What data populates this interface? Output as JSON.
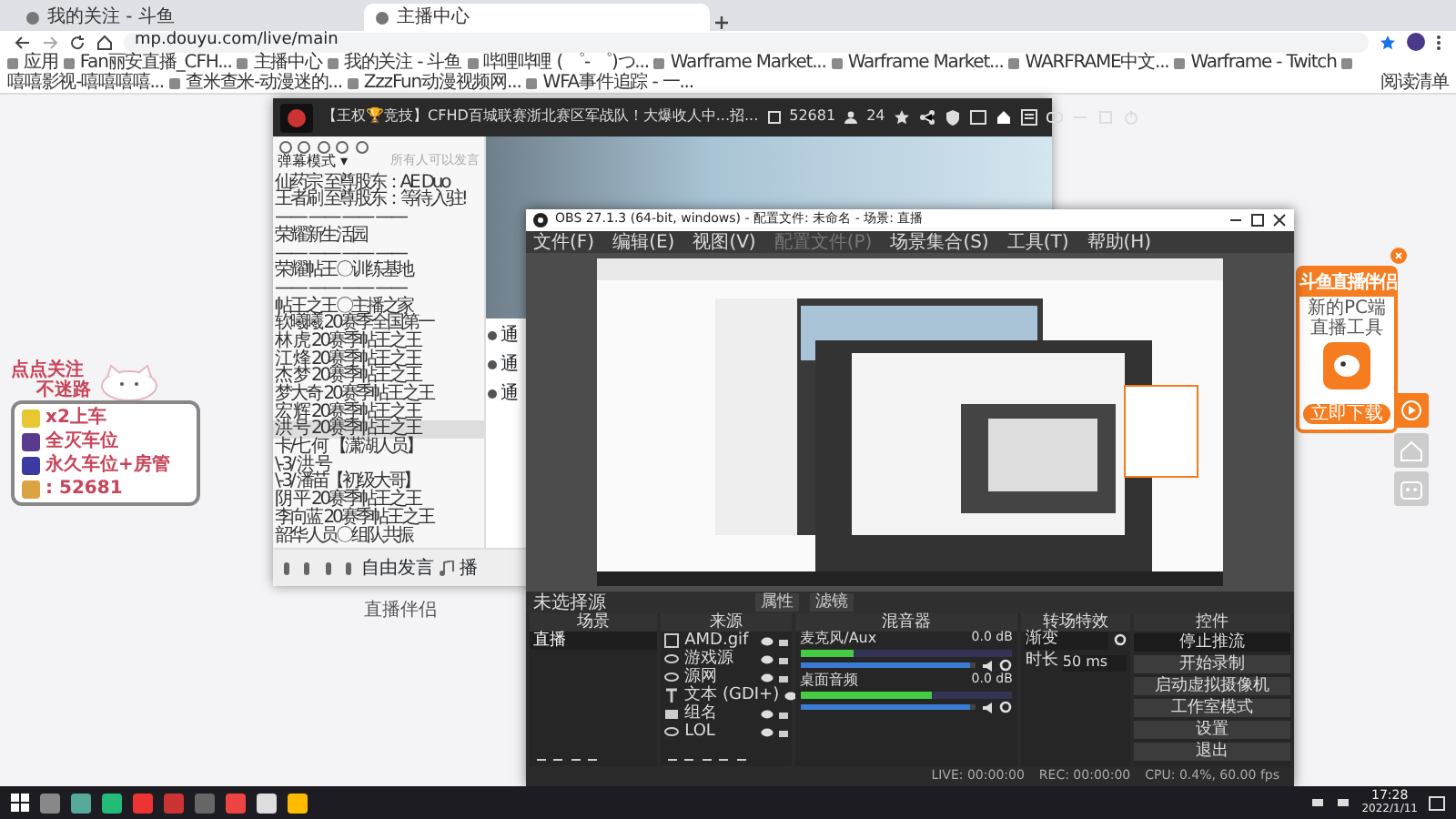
{
  "browser": {
    "tabs": [
      {
        "title": "我的关注 - 斗鱼",
        "selected": false
      },
      {
        "title": "主播中心",
        "selected": true
      }
    ],
    "address": "mp.douyu.com/live/main",
    "bookmarks": [
      "应用",
      "Fan丽安直播_CFH...",
      "主播中心",
      "我的关注 - 斗鱼",
      "哔哩哔哩 ( ゜- ゜)つ...",
      "Warframe Market...",
      "Warframe Market...",
      "WARFRAME中文...",
      "Warframe - Twitch",
      "嘻嘻影视-嘻嘻嘻嘻...",
      "查米查米-动漫迷的...",
      "ZzzFun动漫视频网...",
      "WFA事件追踪 - 一..."
    ],
    "reading_list": "阅读清单"
  },
  "promo_sticker": {
    "headline": [
      "点点关注",
      "不迷路"
    ],
    "items": [
      "x2上车",
      "全灭车位",
      "永久车位+房管",
      ": 52681"
    ]
  },
  "page_links": [
    "通",
    "通",
    "通"
  ],
  "page_footer": "直播伴侣",
  "ad": {
    "title": "斗鱼直播伴侣",
    "subtitle": "新的PC端直播工具",
    "button": "立即下载"
  },
  "player": {
    "title": "【王权🏆竞技】CFHD百城联赛浙北赛区军战队！大爆收人中...招...",
    "viewers": "52681",
    "followers": "24",
    "chat_mode": "弹幕模式 ▾",
    "chat_hint": "所有人可以发言",
    "chat": [
      {
        "text": "仙药宗  至尊股东：AE Duo",
        "selected": false
      },
      {
        "text": "王者刷  至尊股东：等待入驻!",
        "selected": false
      },
      {
        "text": "—— —— —— ——",
        "selected": false
      },
      {
        "text": "荣耀新生活园",
        "selected": false
      },
      {
        "text": "—— —— —— ——",
        "selected": false
      },
      {
        "text": "荣耀帖王〇训练基地",
        "selected": false
      },
      {
        "text": "—— —— —— ——",
        "selected": false
      },
      {
        "text": "帖王之王〇主播之家",
        "selected": false
      },
      {
        "text": "软曦曦  20赛季全国第一",
        "selected": false
      },
      {
        "text": "林  虎  20赛季帖王之王",
        "selected": false
      },
      {
        "text": "江  烽  20赛季帖王之王",
        "selected": false
      },
      {
        "text": "杰  梦  20赛季帖王之王",
        "selected": false
      },
      {
        "text": "梦大奇  20赛季帖王之王",
        "selected": false
      },
      {
        "text": "宏  辉  20赛季帖王之王",
        "selected": false
      },
      {
        "text": "洪  号  20赛季帖王之王",
        "selected": true
      },
      {
        "text": "卡/七 何 【潇湖人员】",
        "selected": false
      },
      {
        "text": "\\-3/ 洪 号",
        "selected": false
      },
      {
        "text": "\\-3/ 潘苗【初级大哥】",
        "selected": false
      },
      {
        "text": "阴  平  20赛季帖王之王",
        "selected": false
      },
      {
        "text": "李向蓝  20赛季帖王之王",
        "selected": false
      },
      {
        "text": "韶华人员〇组队共振",
        "selected": false
      }
    ],
    "send_label": "自由发言",
    "play_label": "播"
  },
  "obs": {
    "title": "OBS 27.1.3 (64-bit, windows) - 配置文件: 未命名 - 场景: 直播",
    "menu": [
      {
        "label": "文件(F)",
        "disabled": false
      },
      {
        "label": "编辑(E)",
        "disabled": false
      },
      {
        "label": "视图(V)",
        "disabled": false
      },
      {
        "label": "配置文件(P)",
        "disabled": true
      },
      {
        "label": "场景集合(S)",
        "disabled": false
      },
      {
        "label": "工具(T)",
        "disabled": false
      },
      {
        "label": "帮助(H)",
        "disabled": false
      }
    ],
    "no_source": "未选择源",
    "properties": "属性",
    "filters": "滤镜",
    "docks": {
      "scenes": "场景",
      "sources": "来源",
      "mixer": "混音器",
      "transitions": "转场特效",
      "controls": "控件"
    },
    "scenes": [
      {
        "name": "直播",
        "selected": true
      }
    ],
    "sources": [
      {
        "name": "AMD.gif",
        "kind": "image"
      },
      {
        "name": "游戏源",
        "kind": "link"
      },
      {
        "name": "源网",
        "kind": "link"
      },
      {
        "name": "文本 (GDI+)",
        "kind": "text"
      },
      {
        "name": "组名",
        "kind": "group"
      },
      {
        "name": "LOL",
        "kind": "link"
      }
    ],
    "mixer": [
      {
        "name": "麦克风/Aux",
        "reading": "0.0 dB",
        "meter": {
          "level": 0.25
        },
        "fader": {
          "level": 0.97
        }
      },
      {
        "name": "桌面音频",
        "reading": "0.0 dB",
        "meter": {
          "level": 0.62
        },
        "fader": {
          "level": 0.97
        }
      }
    ],
    "transition": {
      "name": "渐变",
      "duration_label": "时长",
      "duration": "50 ms"
    },
    "controls": [
      "停止推流",
      "开始录制",
      "启动虚拟摄像机",
      "工作室模式",
      "设置",
      "退出"
    ],
    "status": {
      "live": "LIVE: 00:00:00",
      "rec": "REC: 00:00:00",
      "cpu": "CPU: 0.4%, 60.00 fps"
    }
  },
  "taskbar": {
    "time": "17:28",
    "date": "2022/1/11"
  }
}
